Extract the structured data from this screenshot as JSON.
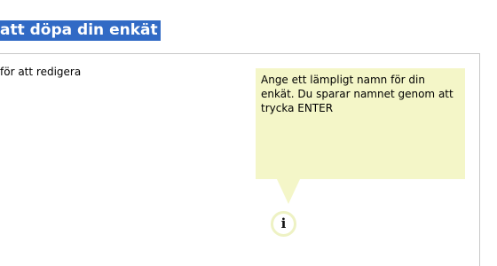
{
  "header": {
    "title": "att döpa din enkät"
  },
  "panel": {
    "hint_text": "för att redigera"
  },
  "tooltip": {
    "text": "Ange ett lämpligt namn för din enkät. Du sparar namnet genom att trycka ENTER",
    "background_color": "#f4f6c8"
  },
  "info_icon": {
    "glyph": "i",
    "icon_name": "info-icon"
  },
  "colors": {
    "title_highlight": "#316ac5",
    "title_text": "#ffffff",
    "panel_border": "#c8c8c8"
  }
}
